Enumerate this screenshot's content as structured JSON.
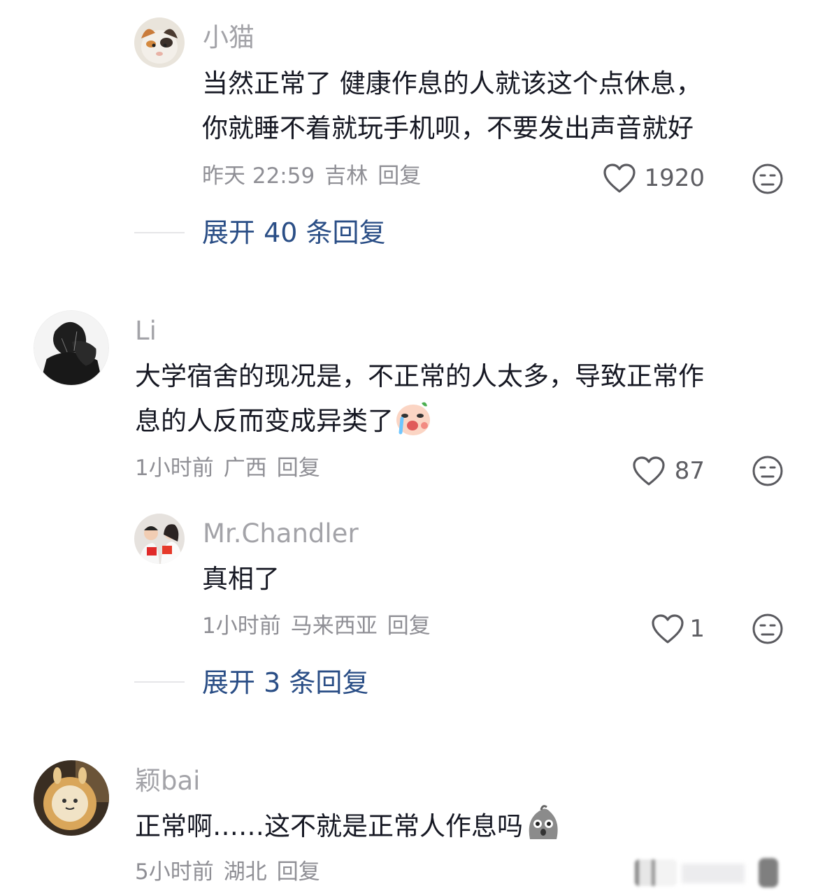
{
  "comments": [
    {
      "username": "小猫",
      "text_lines": [
        "当然正常了 健康作息的人就该这个点休息，",
        "你就睡不着就玩手机呗，不要发出声音就好"
      ],
      "time": "昨天 22:59",
      "location": "吉林",
      "reply_label": "回复",
      "likes": "1920",
      "expand_label": "展开 40 条回复"
    },
    {
      "username": "Li",
      "text_lines": [
        "大学宿舍的现况是，不正常的人太多，导致正常作",
        "息的人反而变成异类了"
      ],
      "emoji": "crying-face-emoji",
      "time": "1小时前",
      "location": "广西",
      "reply_label": "回复",
      "likes": "87"
    },
    {
      "username": "Mr.Chandler",
      "text": "真相了",
      "time": "1小时前",
      "location": "马来西亚",
      "reply_label": "回复",
      "likes": "1",
      "expand_label": "展开 3 条回复"
    },
    {
      "username": "颖bai",
      "text": "正常啊……这不就是正常人作息吗",
      "emoji": "shocked-face-emoji",
      "time": "5小时前",
      "location": "湖北",
      "reply_label": "回复"
    }
  ],
  "icons": {
    "like": "heart-outline-icon",
    "dislike": "unamused-face-icon"
  },
  "colors": {
    "username": "#a3a3a8",
    "text": "#161823",
    "meta": "#8f8f95",
    "expand": "#2a4e86"
  }
}
